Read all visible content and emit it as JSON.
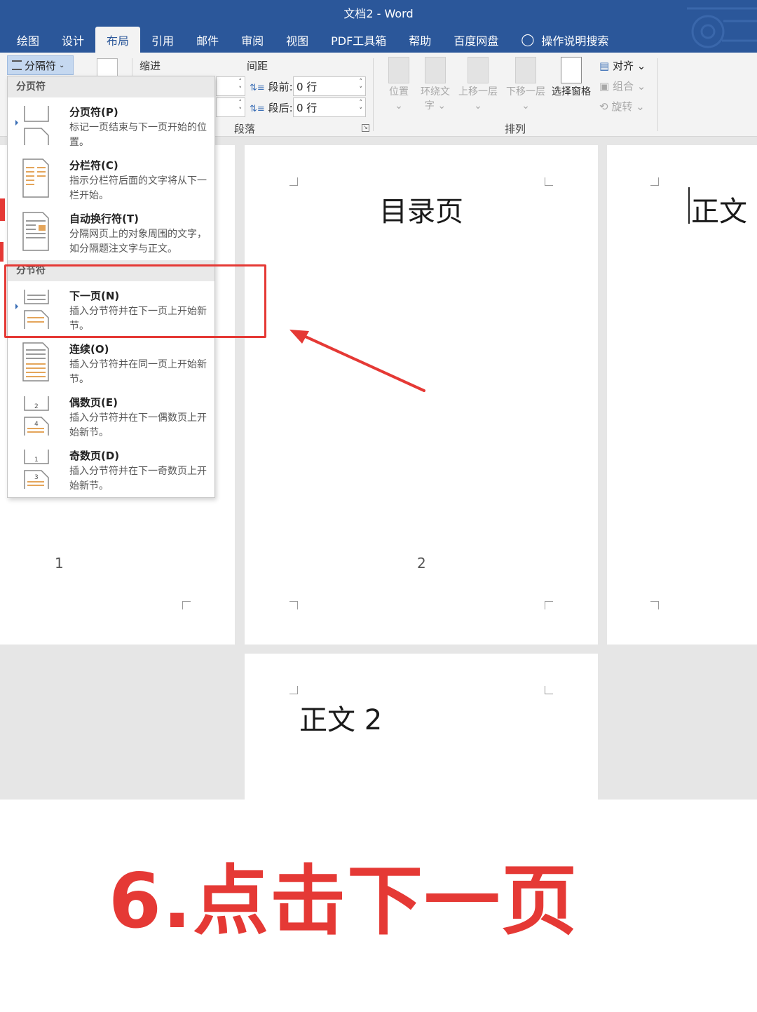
{
  "window": {
    "title": "文档2  -  Word"
  },
  "tabs": [
    {
      "label": "绘图"
    },
    {
      "label": "设计"
    },
    {
      "label": "布局"
    },
    {
      "label": "引用"
    },
    {
      "label": "邮件"
    },
    {
      "label": "审阅"
    },
    {
      "label": "视图"
    },
    {
      "label": "PDF工具箱"
    },
    {
      "label": "帮助"
    },
    {
      "label": "百度网盘"
    },
    {
      "label": "操作说明搜索"
    }
  ],
  "active_tab": "布局",
  "ribbon": {
    "breaks_label": "分隔符",
    "indent_label": "缩进",
    "spacing_label": "间距",
    "before_label": "段前:",
    "before_value": "0 行",
    "after_label": "段后:",
    "after_value": "0 行",
    "paragraph_group": "段落",
    "arrange_group": "排列",
    "position": "位置",
    "wrap_text_1": "环绕文",
    "wrap_text_2": "字",
    "bring_forward": "上移一层",
    "send_backward": "下移一层",
    "selection_pane": "选择窗格",
    "align": "对齐",
    "group": "组合",
    "rotate": "旋转"
  },
  "menu": {
    "page_breaks_header": "分页符",
    "section_breaks_header": "分节符",
    "items": [
      {
        "title": "分页符(P)",
        "desc": "标记一页结束与下一页开始的位置。"
      },
      {
        "title": "分栏符(C)",
        "desc": "指示分栏符后面的文字将从下一栏开始。"
      },
      {
        "title": "自动换行符(T)",
        "desc": "分隔网页上的对象周围的文字，如分隔题注文字与正文。"
      },
      {
        "title": "下一页(N)",
        "desc": "插入分节符并在下一页上开始新节。"
      },
      {
        "title": "连续(O)",
        "desc": "插入分节符并在同一页上开始新节。"
      },
      {
        "title": "偶数页(E)",
        "desc": "插入分节符并在下一偶数页上开始新节。"
      },
      {
        "title": "奇数页(D)",
        "desc": "插入分节符并在下一奇数页上开始新节。"
      }
    ]
  },
  "document": {
    "page1_number": "1",
    "page2_heading": "目录页",
    "page2_number": "2",
    "page3_heading": "正文",
    "page4_heading": "正文 2"
  },
  "caption": "6.点击下一页",
  "colors": {
    "brand": "#2b579a",
    "highlight": "#e53935"
  }
}
